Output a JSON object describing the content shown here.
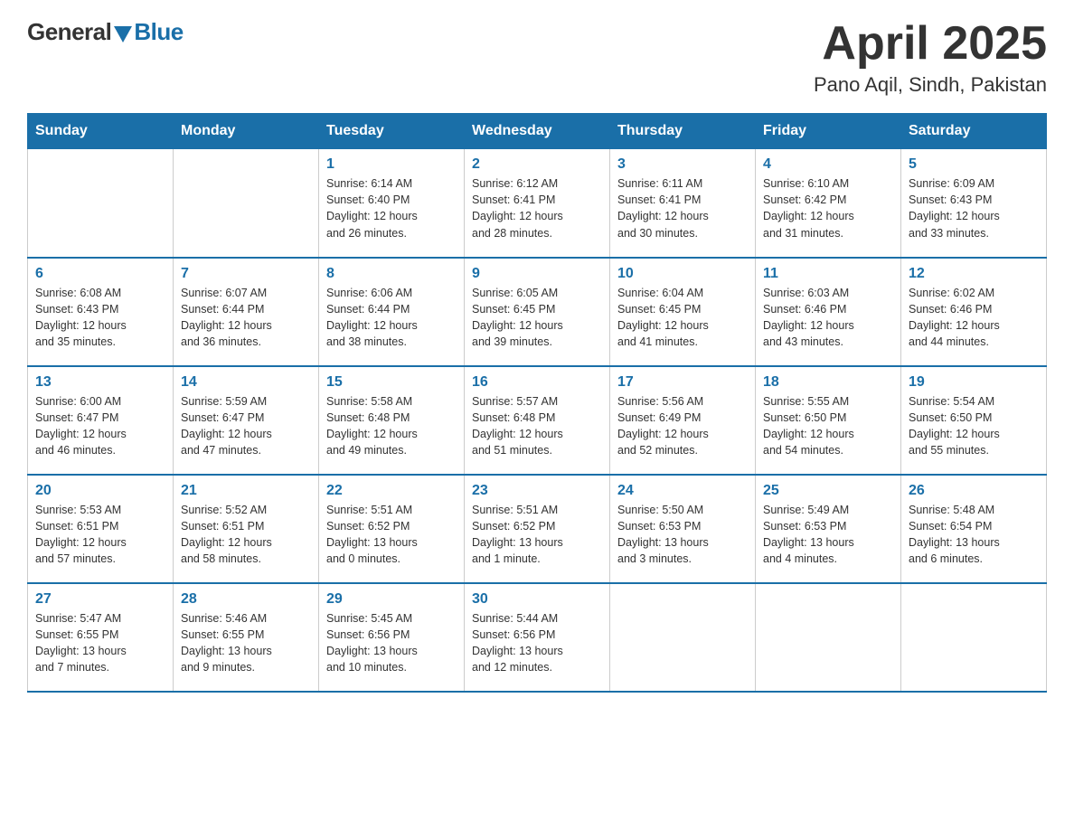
{
  "header": {
    "logo_general": "General",
    "logo_blue": "Blue",
    "month_title": "April 2025",
    "location": "Pano Aqil, Sindh, Pakistan"
  },
  "weekdays": [
    "Sunday",
    "Monday",
    "Tuesday",
    "Wednesday",
    "Thursday",
    "Friday",
    "Saturday"
  ],
  "weeks": [
    [
      {
        "day": "",
        "info": ""
      },
      {
        "day": "",
        "info": ""
      },
      {
        "day": "1",
        "info": "Sunrise: 6:14 AM\nSunset: 6:40 PM\nDaylight: 12 hours\nand 26 minutes."
      },
      {
        "day": "2",
        "info": "Sunrise: 6:12 AM\nSunset: 6:41 PM\nDaylight: 12 hours\nand 28 minutes."
      },
      {
        "day": "3",
        "info": "Sunrise: 6:11 AM\nSunset: 6:41 PM\nDaylight: 12 hours\nand 30 minutes."
      },
      {
        "day": "4",
        "info": "Sunrise: 6:10 AM\nSunset: 6:42 PM\nDaylight: 12 hours\nand 31 minutes."
      },
      {
        "day": "5",
        "info": "Sunrise: 6:09 AM\nSunset: 6:43 PM\nDaylight: 12 hours\nand 33 minutes."
      }
    ],
    [
      {
        "day": "6",
        "info": "Sunrise: 6:08 AM\nSunset: 6:43 PM\nDaylight: 12 hours\nand 35 minutes."
      },
      {
        "day": "7",
        "info": "Sunrise: 6:07 AM\nSunset: 6:44 PM\nDaylight: 12 hours\nand 36 minutes."
      },
      {
        "day": "8",
        "info": "Sunrise: 6:06 AM\nSunset: 6:44 PM\nDaylight: 12 hours\nand 38 minutes."
      },
      {
        "day": "9",
        "info": "Sunrise: 6:05 AM\nSunset: 6:45 PM\nDaylight: 12 hours\nand 39 minutes."
      },
      {
        "day": "10",
        "info": "Sunrise: 6:04 AM\nSunset: 6:45 PM\nDaylight: 12 hours\nand 41 minutes."
      },
      {
        "day": "11",
        "info": "Sunrise: 6:03 AM\nSunset: 6:46 PM\nDaylight: 12 hours\nand 43 minutes."
      },
      {
        "day": "12",
        "info": "Sunrise: 6:02 AM\nSunset: 6:46 PM\nDaylight: 12 hours\nand 44 minutes."
      }
    ],
    [
      {
        "day": "13",
        "info": "Sunrise: 6:00 AM\nSunset: 6:47 PM\nDaylight: 12 hours\nand 46 minutes."
      },
      {
        "day": "14",
        "info": "Sunrise: 5:59 AM\nSunset: 6:47 PM\nDaylight: 12 hours\nand 47 minutes."
      },
      {
        "day": "15",
        "info": "Sunrise: 5:58 AM\nSunset: 6:48 PM\nDaylight: 12 hours\nand 49 minutes."
      },
      {
        "day": "16",
        "info": "Sunrise: 5:57 AM\nSunset: 6:48 PM\nDaylight: 12 hours\nand 51 minutes."
      },
      {
        "day": "17",
        "info": "Sunrise: 5:56 AM\nSunset: 6:49 PM\nDaylight: 12 hours\nand 52 minutes."
      },
      {
        "day": "18",
        "info": "Sunrise: 5:55 AM\nSunset: 6:50 PM\nDaylight: 12 hours\nand 54 minutes."
      },
      {
        "day": "19",
        "info": "Sunrise: 5:54 AM\nSunset: 6:50 PM\nDaylight: 12 hours\nand 55 minutes."
      }
    ],
    [
      {
        "day": "20",
        "info": "Sunrise: 5:53 AM\nSunset: 6:51 PM\nDaylight: 12 hours\nand 57 minutes."
      },
      {
        "day": "21",
        "info": "Sunrise: 5:52 AM\nSunset: 6:51 PM\nDaylight: 12 hours\nand 58 minutes."
      },
      {
        "day": "22",
        "info": "Sunrise: 5:51 AM\nSunset: 6:52 PM\nDaylight: 13 hours\nand 0 minutes."
      },
      {
        "day": "23",
        "info": "Sunrise: 5:51 AM\nSunset: 6:52 PM\nDaylight: 13 hours\nand 1 minute."
      },
      {
        "day": "24",
        "info": "Sunrise: 5:50 AM\nSunset: 6:53 PM\nDaylight: 13 hours\nand 3 minutes."
      },
      {
        "day": "25",
        "info": "Sunrise: 5:49 AM\nSunset: 6:53 PM\nDaylight: 13 hours\nand 4 minutes."
      },
      {
        "day": "26",
        "info": "Sunrise: 5:48 AM\nSunset: 6:54 PM\nDaylight: 13 hours\nand 6 minutes."
      }
    ],
    [
      {
        "day": "27",
        "info": "Sunrise: 5:47 AM\nSunset: 6:55 PM\nDaylight: 13 hours\nand 7 minutes."
      },
      {
        "day": "28",
        "info": "Sunrise: 5:46 AM\nSunset: 6:55 PM\nDaylight: 13 hours\nand 9 minutes."
      },
      {
        "day": "29",
        "info": "Sunrise: 5:45 AM\nSunset: 6:56 PM\nDaylight: 13 hours\nand 10 minutes."
      },
      {
        "day": "30",
        "info": "Sunrise: 5:44 AM\nSunset: 6:56 PM\nDaylight: 13 hours\nand 12 minutes."
      },
      {
        "day": "",
        "info": ""
      },
      {
        "day": "",
        "info": ""
      },
      {
        "day": "",
        "info": ""
      }
    ]
  ]
}
